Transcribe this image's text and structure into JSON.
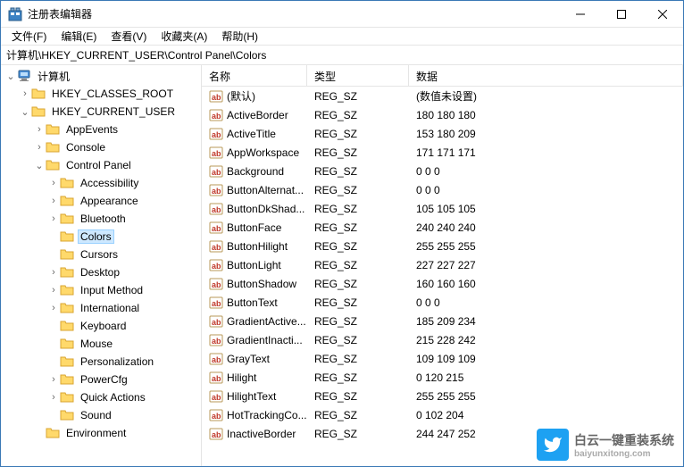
{
  "window": {
    "title": "注册表编辑器"
  },
  "menu": {
    "file": "文件(F)",
    "edit": "编辑(E)",
    "view": "查看(V)",
    "favorites": "收藏夹(A)",
    "help": "帮助(H)"
  },
  "addressbar": {
    "path": "计算机\\HKEY_CURRENT_USER\\Control Panel\\Colors"
  },
  "tree": [
    {
      "label": "计算机",
      "depth": 0,
      "expanded": true,
      "icon": "computer"
    },
    {
      "label": "HKEY_CLASSES_ROOT",
      "depth": 1,
      "expanded": false,
      "icon": "folder"
    },
    {
      "label": "HKEY_CURRENT_USER",
      "depth": 1,
      "expanded": true,
      "icon": "folder"
    },
    {
      "label": "AppEvents",
      "depth": 2,
      "expanded": false,
      "icon": "folder"
    },
    {
      "label": "Console",
      "depth": 2,
      "expanded": false,
      "icon": "folder"
    },
    {
      "label": "Control Panel",
      "depth": 2,
      "expanded": true,
      "icon": "folder"
    },
    {
      "label": "Accessibility",
      "depth": 3,
      "expanded": false,
      "icon": "folder"
    },
    {
      "label": "Appearance",
      "depth": 3,
      "expanded": false,
      "icon": "folder"
    },
    {
      "label": "Bluetooth",
      "depth": 3,
      "expanded": false,
      "icon": "folder"
    },
    {
      "label": "Colors",
      "depth": 3,
      "expanded": null,
      "icon": "folder",
      "selected": true
    },
    {
      "label": "Cursors",
      "depth": 3,
      "expanded": null,
      "icon": "folder"
    },
    {
      "label": "Desktop",
      "depth": 3,
      "expanded": false,
      "icon": "folder"
    },
    {
      "label": "Input Method",
      "depth": 3,
      "expanded": false,
      "icon": "folder"
    },
    {
      "label": "International",
      "depth": 3,
      "expanded": false,
      "icon": "folder"
    },
    {
      "label": "Keyboard",
      "depth": 3,
      "expanded": null,
      "icon": "folder"
    },
    {
      "label": "Mouse",
      "depth": 3,
      "expanded": null,
      "icon": "folder"
    },
    {
      "label": "Personalization",
      "depth": 3,
      "expanded": null,
      "icon": "folder"
    },
    {
      "label": "PowerCfg",
      "depth": 3,
      "expanded": false,
      "icon": "folder"
    },
    {
      "label": "Quick Actions",
      "depth": 3,
      "expanded": false,
      "icon": "folder"
    },
    {
      "label": "Sound",
      "depth": 3,
      "expanded": null,
      "icon": "folder"
    },
    {
      "label": "Environment",
      "depth": 2,
      "expanded": null,
      "icon": "folder"
    }
  ],
  "list": {
    "headers": {
      "name": "名称",
      "type": "类型",
      "data": "数据"
    },
    "rows": [
      {
        "name": "(默认)",
        "type": "REG_SZ",
        "data": "(数值未设置)"
      },
      {
        "name": "ActiveBorder",
        "type": "REG_SZ",
        "data": "180 180 180"
      },
      {
        "name": "ActiveTitle",
        "type": "REG_SZ",
        "data": "153 180 209"
      },
      {
        "name": "AppWorkspace",
        "type": "REG_SZ",
        "data": "171 171 171"
      },
      {
        "name": "Background",
        "type": "REG_SZ",
        "data": "0 0 0"
      },
      {
        "name": "ButtonAlternat...",
        "type": "REG_SZ",
        "data": "0 0 0"
      },
      {
        "name": "ButtonDkShad...",
        "type": "REG_SZ",
        "data": "105 105 105"
      },
      {
        "name": "ButtonFace",
        "type": "REG_SZ",
        "data": "240 240 240"
      },
      {
        "name": "ButtonHilight",
        "type": "REG_SZ",
        "data": "255 255 255"
      },
      {
        "name": "ButtonLight",
        "type": "REG_SZ",
        "data": "227 227 227"
      },
      {
        "name": "ButtonShadow",
        "type": "REG_SZ",
        "data": "160 160 160"
      },
      {
        "name": "ButtonText",
        "type": "REG_SZ",
        "data": "0 0 0"
      },
      {
        "name": "GradientActive...",
        "type": "REG_SZ",
        "data": "185 209 234"
      },
      {
        "name": "GradientInacti...",
        "type": "REG_SZ",
        "data": "215 228 242"
      },
      {
        "name": "GrayText",
        "type": "REG_SZ",
        "data": "109 109 109"
      },
      {
        "name": "Hilight",
        "type": "REG_SZ",
        "data": "0 120 215"
      },
      {
        "name": "HilightText",
        "type": "REG_SZ",
        "data": "255 255 255"
      },
      {
        "name": "HotTrackingCo...",
        "type": "REG_SZ",
        "data": "0 102 204"
      },
      {
        "name": "InactiveBorder",
        "type": "REG_SZ",
        "data": "244 247 252"
      }
    ]
  },
  "watermark": {
    "text1": "白云一键重装系统",
    "text2": "baiyunxitong.com"
  }
}
